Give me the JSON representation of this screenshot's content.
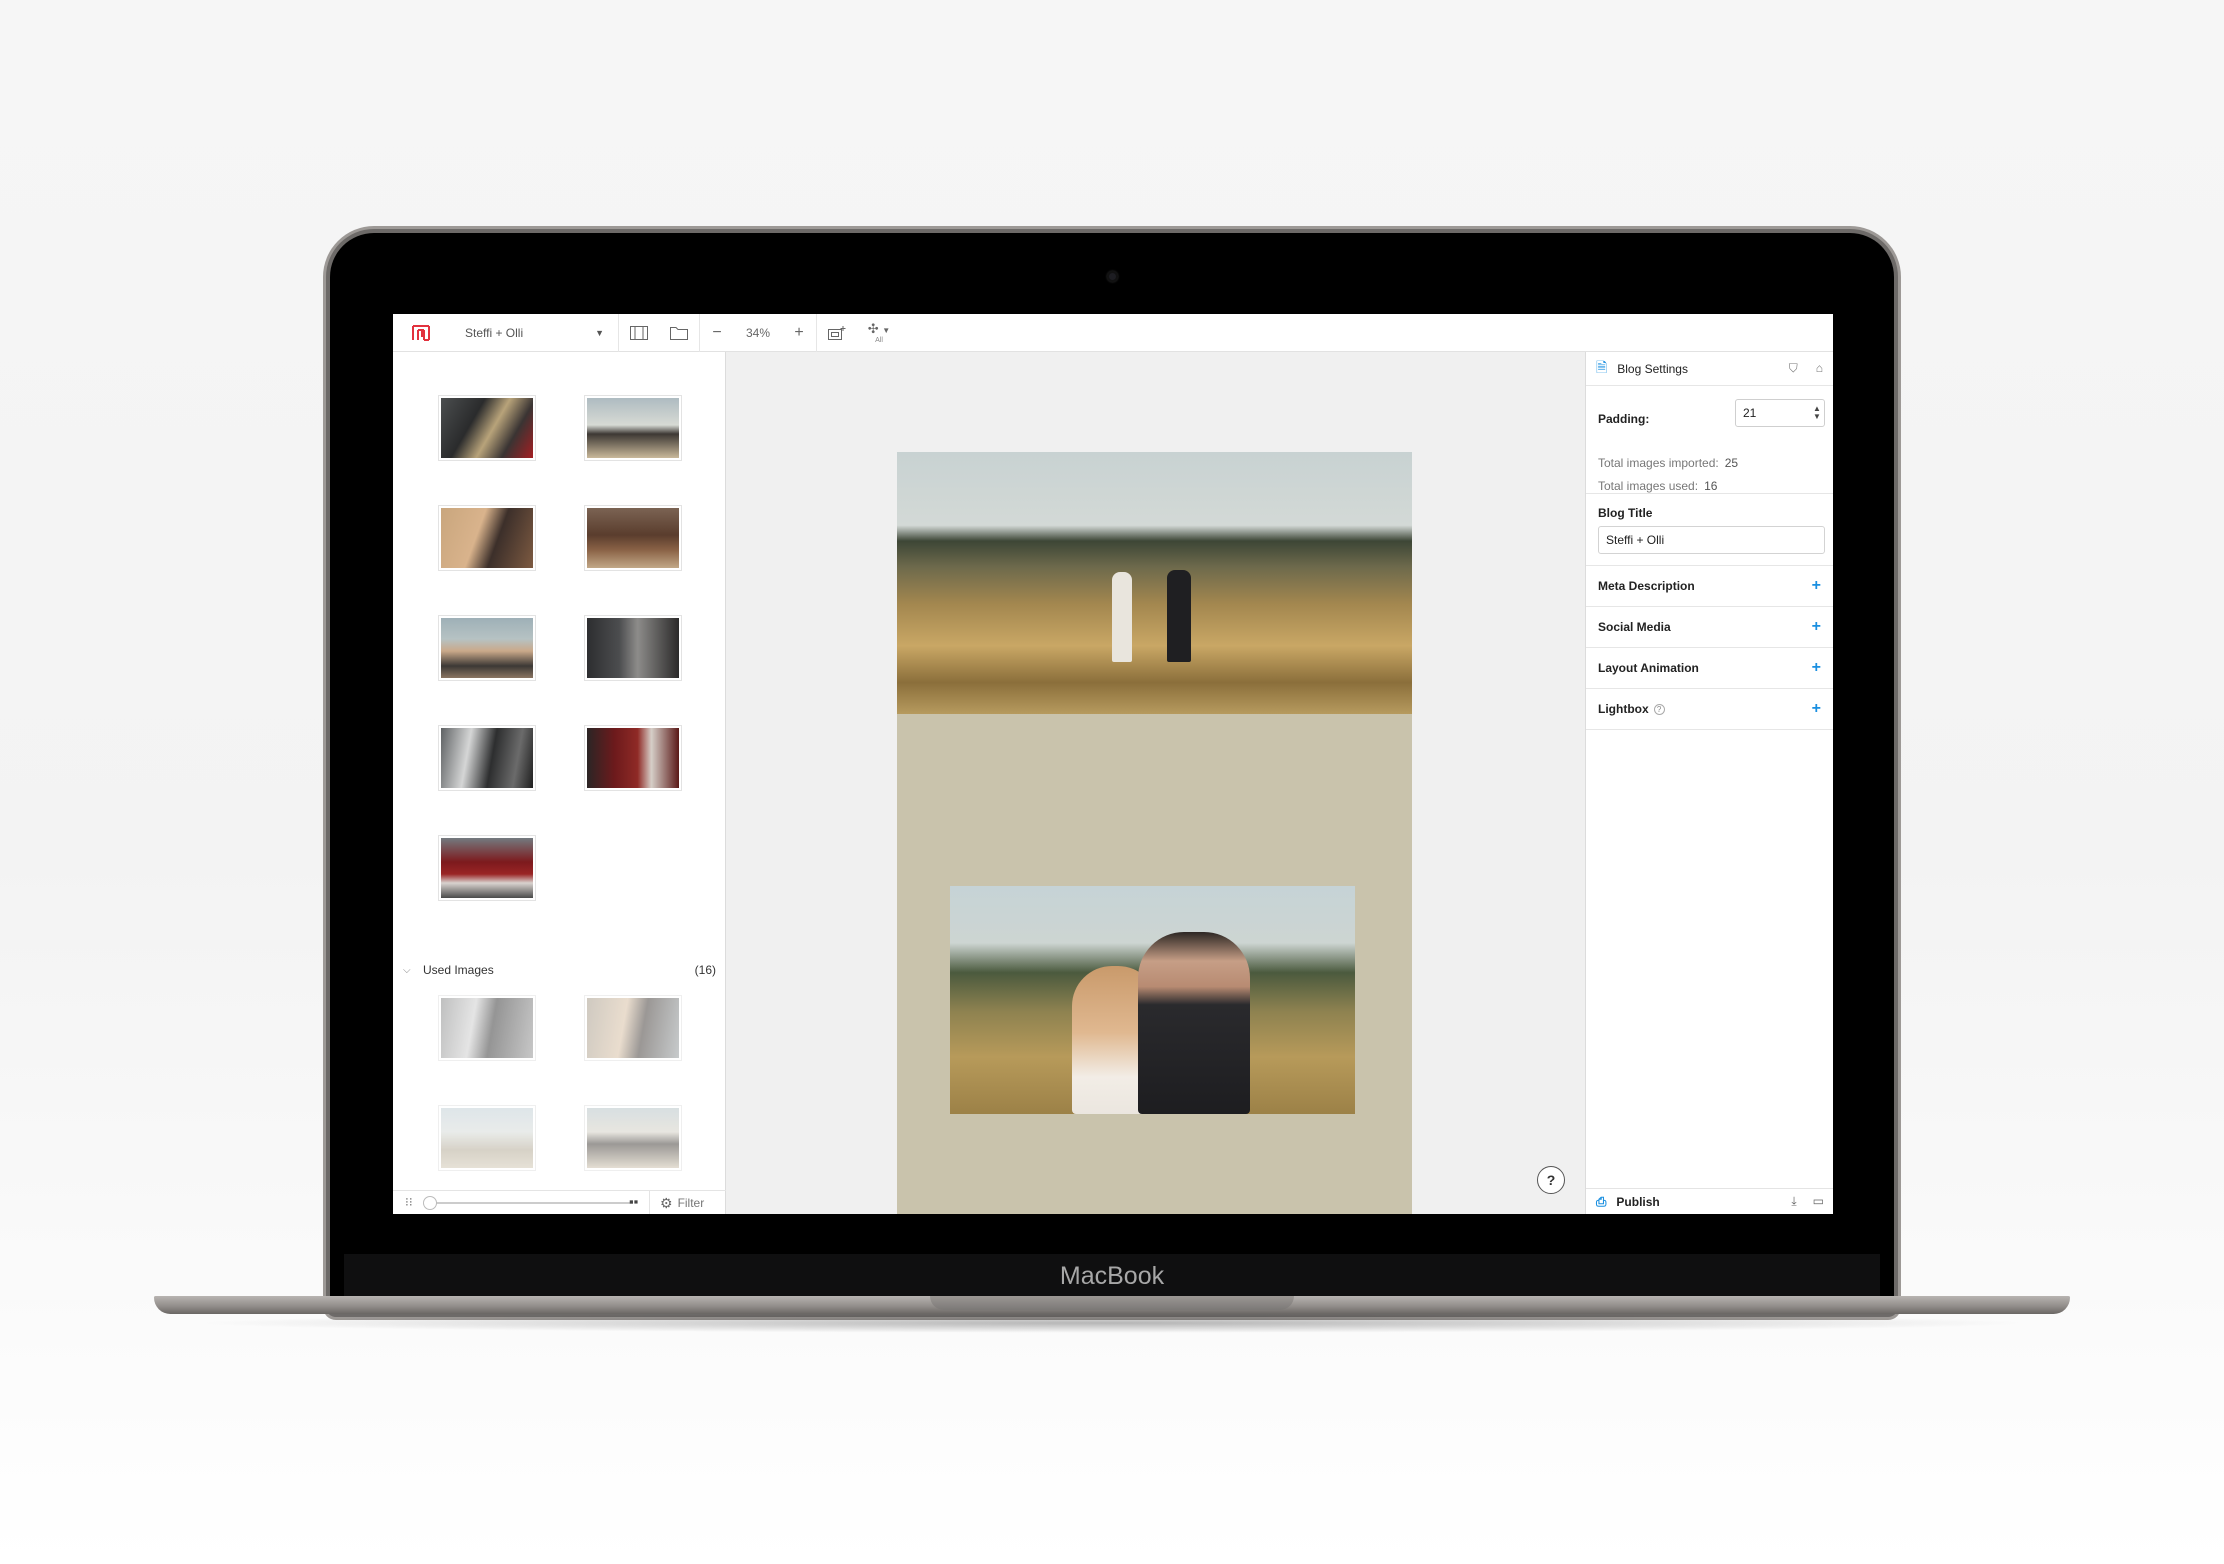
{
  "device": {
    "brand": "MacBook"
  },
  "toolbar": {
    "document_name": "Steffi + Olli",
    "zoom_level": "34%",
    "zoom_out": "−",
    "zoom_in": "+",
    "alignment_label": "All",
    "accent_color": "#e2323e"
  },
  "library": {
    "used_images": {
      "label": "Used Images",
      "count": "(16)"
    },
    "filter_label": "Filter"
  },
  "canvas": {
    "page_background": "#c9c3ac",
    "help_label": "?"
  },
  "settings": {
    "header_title": "Blog Settings",
    "padding_label": "Padding:",
    "padding_value": "21",
    "total_imported_label": "Total images imported:",
    "total_imported_value": "25",
    "total_used_label": "Total images used:",
    "total_used_value": "16",
    "blog_title_label": "Blog Title",
    "blog_title_value": "Steffi + Olli",
    "sections": [
      {
        "label": "Meta Description"
      },
      {
        "label": "Social Media"
      },
      {
        "label": "Layout Animation"
      },
      {
        "label": "Lightbox"
      }
    ],
    "publish_label": "Publish",
    "plus_color": "#1a8fe0"
  }
}
